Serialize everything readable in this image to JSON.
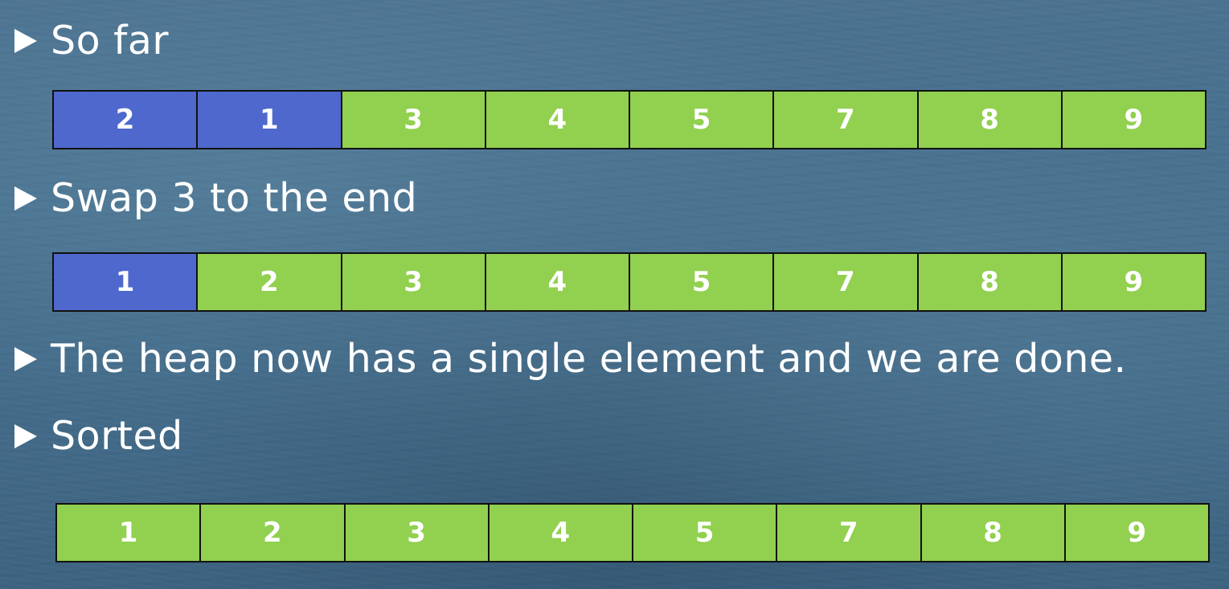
{
  "bullets": [
    "So far",
    "Swap 3 to the end",
    "The heap now has a single element and we are done.",
    "Sorted"
  ],
  "arrays": [
    {
      "cells": [
        {
          "value": "2",
          "state": "heap"
        },
        {
          "value": "1",
          "state": "heap"
        },
        {
          "value": "3",
          "state": "sorted"
        },
        {
          "value": "4",
          "state": "sorted"
        },
        {
          "value": "5",
          "state": "sorted"
        },
        {
          "value": "7",
          "state": "sorted"
        },
        {
          "value": "8",
          "state": "sorted"
        },
        {
          "value": "9",
          "state": "sorted"
        }
      ]
    },
    {
      "cells": [
        {
          "value": "1",
          "state": "heap"
        },
        {
          "value": "2",
          "state": "sorted"
        },
        {
          "value": "3",
          "state": "sorted"
        },
        {
          "value": "4",
          "state": "sorted"
        },
        {
          "value": "5",
          "state": "sorted"
        },
        {
          "value": "7",
          "state": "sorted"
        },
        {
          "value": "8",
          "state": "sorted"
        },
        {
          "value": "9",
          "state": "sorted"
        }
      ]
    },
    {
      "cells": [
        {
          "value": "1",
          "state": "sorted"
        },
        {
          "value": "2",
          "state": "sorted"
        },
        {
          "value": "3",
          "state": "sorted"
        },
        {
          "value": "4",
          "state": "sorted"
        },
        {
          "value": "5",
          "state": "sorted"
        },
        {
          "value": "7",
          "state": "sorted"
        },
        {
          "value": "8",
          "state": "sorted"
        },
        {
          "value": "9",
          "state": "sorted"
        }
      ]
    }
  ],
  "colors": {
    "heap": "#4f68cd",
    "sorted": "#92d050",
    "text": "#ffffff",
    "background": "#46708e"
  }
}
